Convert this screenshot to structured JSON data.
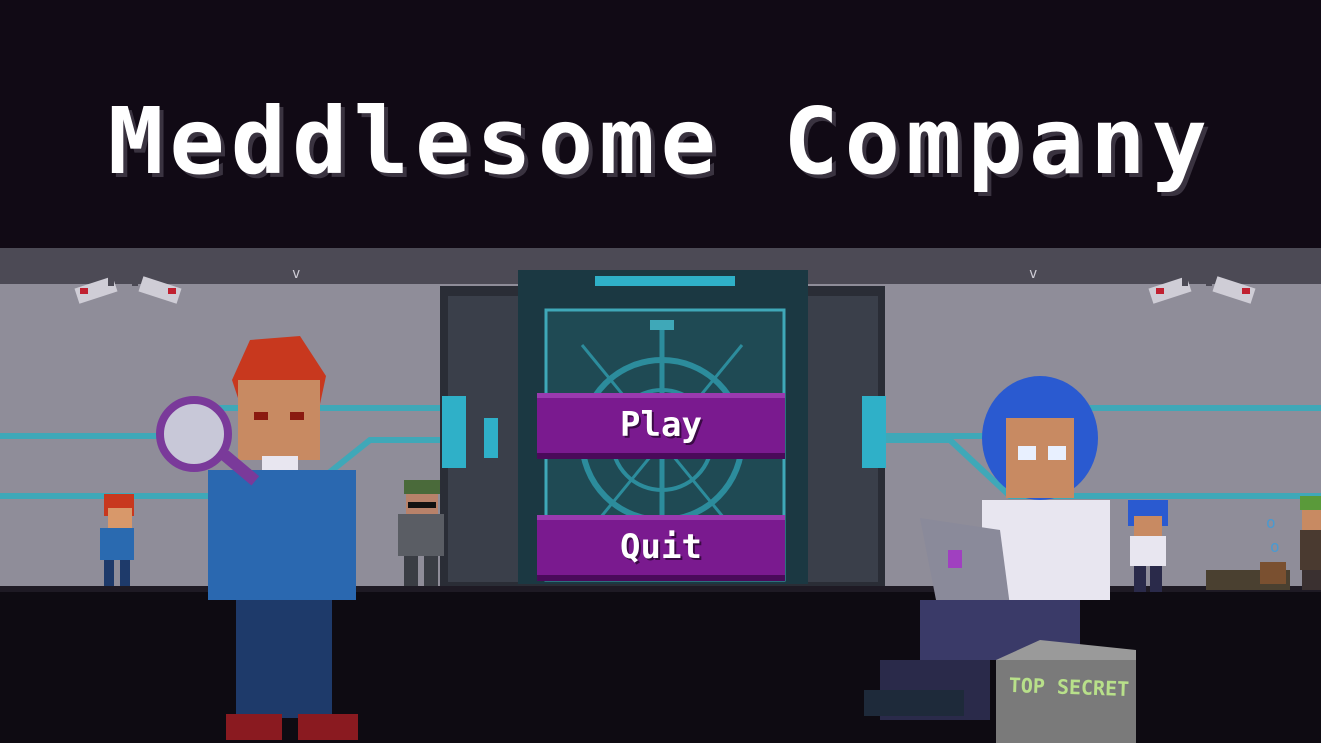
{
  "game": {
    "title": "Meddlesome Company",
    "menu": {
      "play_label": "Play",
      "quit_label": "Quit"
    },
    "crate_label": "TOP SECRET"
  },
  "colors": {
    "background": "#110a15",
    "button": "#7a1a8f",
    "wall": "#8f8d99",
    "floor": "#0e0b12",
    "accent_cyan": "#3fa8b8"
  }
}
